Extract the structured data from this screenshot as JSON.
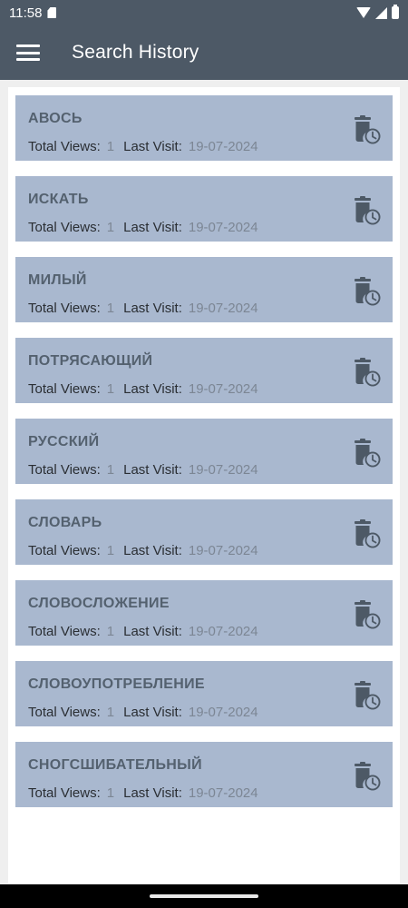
{
  "status_bar": {
    "time": "11:58"
  },
  "app_bar": {
    "title": "Search History",
    "menu_icon": "hamburger-menu-icon"
  },
  "history": {
    "labels": {
      "total_views": "Total Views:",
      "last_visit": "Last Visit:"
    },
    "items": [
      {
        "word": "АВОСЬ",
        "views": "1",
        "date": "19-07-2024"
      },
      {
        "word": "ИСКАТЬ",
        "views": "1",
        "date": "19-07-2024"
      },
      {
        "word": "МИЛЫЙ",
        "views": "1",
        "date": "19-07-2024"
      },
      {
        "word": "ПОТРЯСАЮЩИЙ",
        "views": "1",
        "date": "19-07-2024"
      },
      {
        "word": "РУССКИЙ",
        "views": "1",
        "date": "19-07-2024"
      },
      {
        "word": "СЛОВАРЬ",
        "views": "1",
        "date": "19-07-2024"
      },
      {
        "word": "СЛОВОСЛОЖЕНИЕ",
        "views": "1",
        "date": "19-07-2024"
      },
      {
        "word": "СЛОВОУПОТРЕБЛЕНИЕ",
        "views": "1",
        "date": "19-07-2024"
      },
      {
        "word": "СНОГСШИБАТЕЛЬНЫЙ",
        "views": "1",
        "date": "19-07-2024"
      }
    ]
  },
  "colors": {
    "app_bar": "#4d5966",
    "card": "#a9b8cf",
    "word_text": "#54616f",
    "icon": "#4d5966"
  }
}
